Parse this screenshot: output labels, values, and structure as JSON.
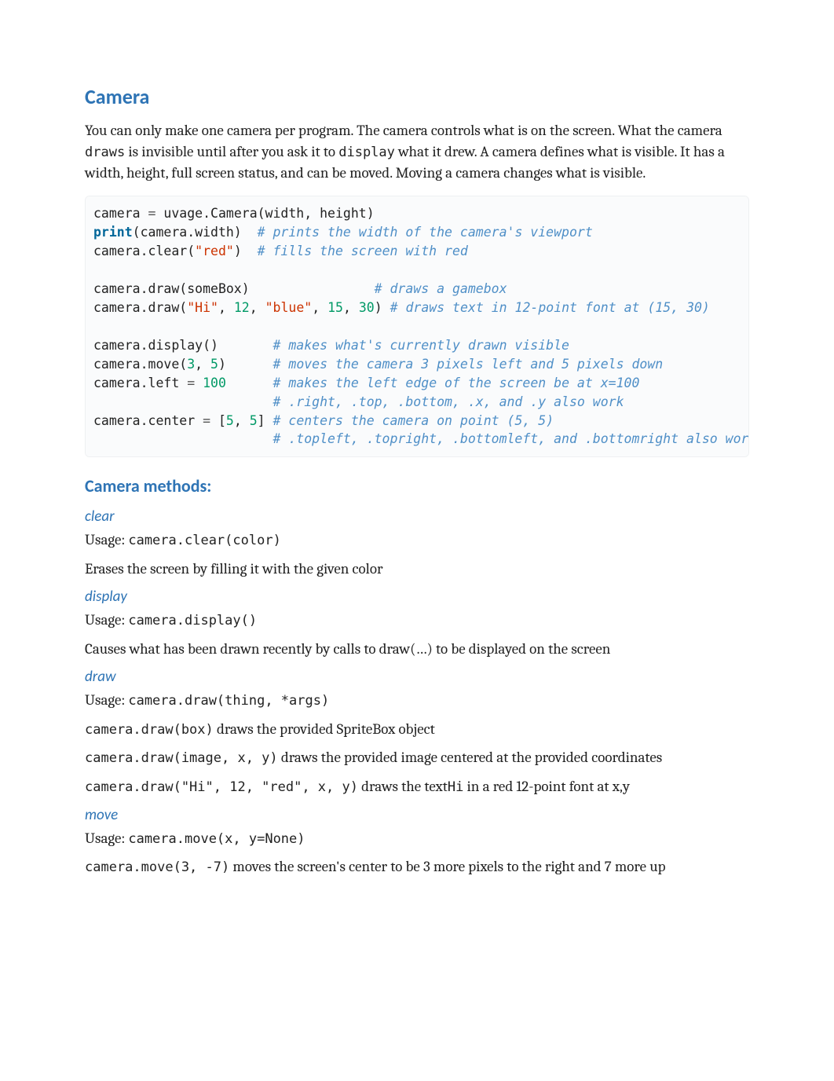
{
  "heading": "Camera",
  "intro": {
    "p1a": "You can only make one camera per program. The camera controls what is on the screen. What the camera ",
    "draws": "draws",
    "p1b": " is invisible until after you ask it to ",
    "display": "display",
    "p1c": " what it drew. A camera defines what is visible. It has a width, height, full screen status, and can be moved. Moving a camera changes what is visible."
  },
  "code": {
    "l1a": "camera ",
    "l1eq": "=",
    "l1b": " uvage.Camera(width, height)",
    "l2a": "print",
    "l2b": "(camera.width)  ",
    "l2c": "# prints the width of the camera's viewport",
    "l3a": "camera.clear(",
    "l3s": "\"red\"",
    "l3b": ")  ",
    "l3c": "# fills the screen with red",
    "blank1": "",
    "l4a": "camera.draw(someBox)                ",
    "l4c": "# draws a gamebox",
    "l5a": "camera.draw(",
    "l5s": "\"Hi\"",
    "l5b": ", ",
    "l5n1": "12",
    "l5c1": ", ",
    "l5s2": "\"blue\"",
    "l5c2": ", ",
    "l5n2": "15",
    "l5c3": ", ",
    "l5n3": "30",
    "l5d": ") ",
    "l5cmt": "# draws text in 12-point font at (15, 30)",
    "blank2": "",
    "l6a": "camera.display()       ",
    "l6c": "# makes what's currently drawn visible",
    "l7a": "camera.move(",
    "l7n1": "3",
    "l7b": ", ",
    "l7n2": "5",
    "l7c": ")      ",
    "l7cmt": "# moves the camera 3 pixels left and 5 pixels down",
    "l8a": "camera.left ",
    "l8eq": "=",
    "l8b": " ",
    "l8n": "100",
    "l8c": "      ",
    "l8cmt": "# makes the left edge of the screen be at x=100",
    "l9pad": "                       ",
    "l9cmt": "# .right, .top, .bottom, .x, and .y also work",
    "l10a": "camera.center ",
    "l10eq": "=",
    "l10b": " [",
    "l10n1": "5",
    "l10c": ", ",
    "l10n2": "5",
    "l10d": "] ",
    "l10cmt": "# centers the camera on point (5, 5)",
    "l11pad": "                       ",
    "l11cmt": "# .topleft, .topright, .bottomleft, and .bottomright also work"
  },
  "methods_heading": "Camera methods:",
  "usage_label": "Usage: ",
  "methods": {
    "clear": {
      "name": "clear",
      "usage": "camera.clear(color)",
      "desc": "Erases the screen by filling it with the given color"
    },
    "display": {
      "name": "display",
      "usage": "camera.display()",
      "desc": "Causes what has been drawn recently by calls to draw(…) to be displayed on the screen"
    },
    "draw": {
      "name": "draw",
      "usage": "camera.draw(thing, *args)",
      "ex1_code": "camera.draw(box)",
      "ex1_text": " draws the provided SpriteBox object",
      "ex2_code": "camera.draw(image, x, y)",
      "ex2_text": " draws the provided image centered at the provided coordinates",
      "ex3_code": "camera.draw(\"Hi\", 12, \"red\", x, y)",
      "ex3_text_a": " draws the text",
      "ex3_hi": "Hi",
      "ex3_text_b": " in a red 12-point font at x,y"
    },
    "move": {
      "name": "move",
      "usage": "camera.move(x, y=None)",
      "ex_code": "camera.move(3, -7)",
      "ex_text": " moves the screen's center to be 3 more pixels to the right and 7 more up"
    }
  }
}
